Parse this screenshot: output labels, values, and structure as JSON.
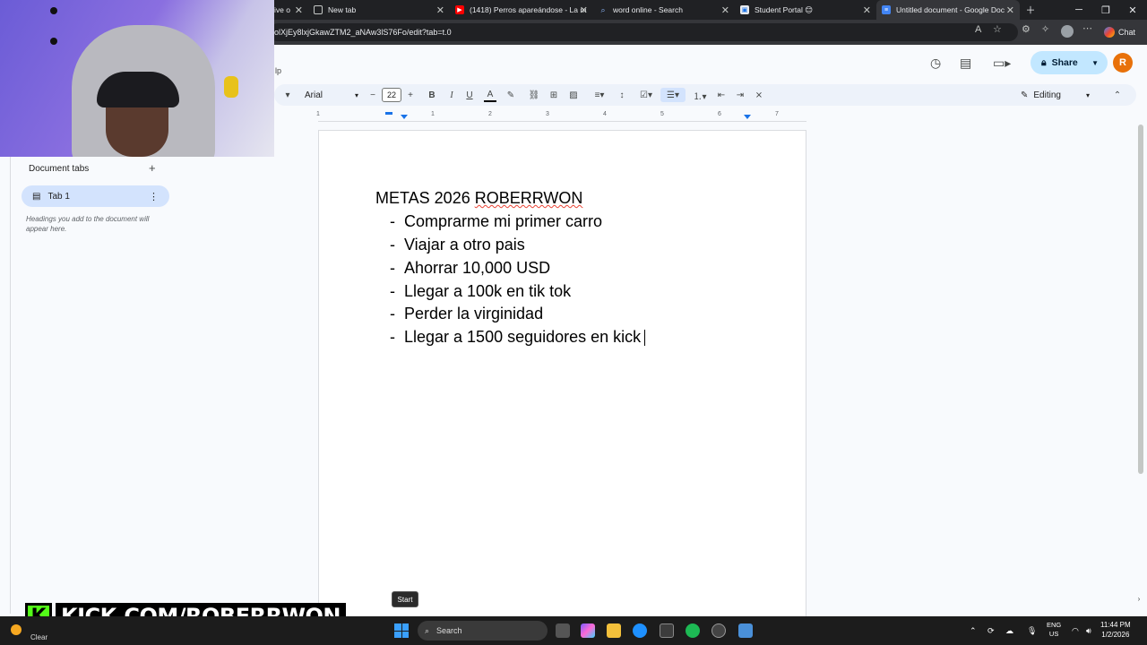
{
  "browser": {
    "tabs": [
      {
        "label": "ive o",
        "favicon": "drive-icon"
      },
      {
        "label": "New tab",
        "favicon": "newtab-icon"
      },
      {
        "label": "(1418) Perros apareándose - La m",
        "favicon": "youtube-icon"
      },
      {
        "label": "word online - Search",
        "favicon": "search-icon"
      },
      {
        "label": "Student Portal 😊",
        "favicon": "portal-icon"
      },
      {
        "label": "Untitled document - Google Doc",
        "favicon": "docs-icon"
      }
    ],
    "url": "olXjEy8lxjGkawZTM2_aNAw3lS76Fo/edit?tab=t.0",
    "chat_label": "Chat"
  },
  "docs": {
    "menu_fragment": "lp",
    "share_label": "Share",
    "avatar_letter": "R",
    "toolbar": {
      "font": "Arial",
      "font_size": "22",
      "mode": "Editing"
    },
    "ruler_numbers": [
      "1",
      "1",
      "2",
      "3",
      "4",
      "5",
      "6",
      "7"
    ],
    "side_panel": {
      "title": "Document tabs",
      "tab_label": "Tab 1",
      "hint": "Headings you add to the document will appear here."
    },
    "document": {
      "title_part1": "METAS 2026 ",
      "title_part2": "ROBERRWON",
      "goals": [
        "Comprarme mi primer carro",
        "Viajar a otro pais",
        "Ahorrar 10,000 USD",
        "Llegar a 100k en tik tok",
        "Perder la virginidad",
        "Llegar a 1500 seguidores en kick"
      ],
      "dash": "-"
    }
  },
  "overlay": {
    "kick_logo": "K",
    "kick_text": "KICK.COM/ROBERRWON",
    "tooltip": "Start"
  },
  "taskbar": {
    "weather_label": "Clear",
    "search_label": "Search",
    "lang_line1": "ENG",
    "lang_line2": "US",
    "time": "11:44 PM",
    "date": "1/2/2026"
  },
  "colors": {
    "share_bg": "#c2e7ff",
    "avatar_bg": "#e8710a",
    "kick_green": "#53fc18",
    "toolbar_bg": "#edf2fa"
  }
}
